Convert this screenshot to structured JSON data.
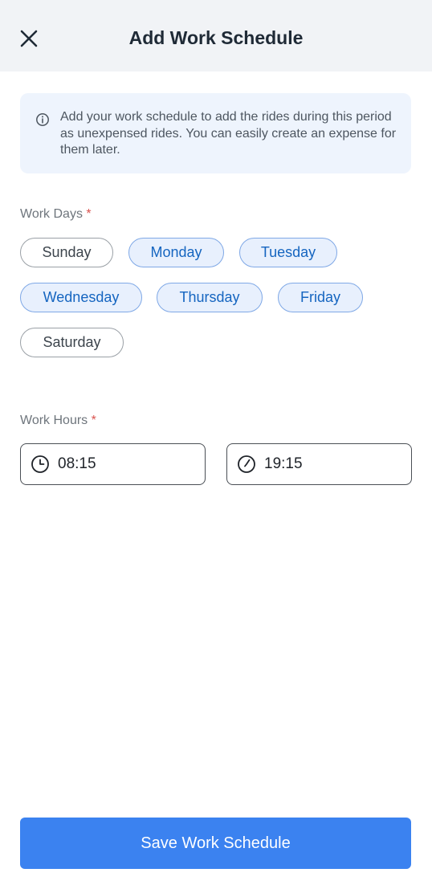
{
  "header": {
    "title": "Add Work Schedule",
    "close_icon": "close-icon"
  },
  "info": {
    "icon": "info-icon",
    "lines": [
      "Add your work schedule to add the rides during this period",
      "as unexpensed rides. You can easily create an expense for",
      "them later."
    ]
  },
  "work_days": {
    "label": "Work Days",
    "required_mark": "*",
    "days": [
      {
        "label": "Sunday",
        "selected": false
      },
      {
        "label": "Monday",
        "selected": true
      },
      {
        "label": "Tuesday",
        "selected": true
      },
      {
        "label": "Wednesday",
        "selected": true
      },
      {
        "label": "Thursday",
        "selected": true
      },
      {
        "label": "Friday",
        "selected": true
      },
      {
        "label": "Saturday",
        "selected": false
      }
    ]
  },
  "work_hours": {
    "label": "Work Hours",
    "required_mark": "*",
    "start": {
      "value": "08:15",
      "icon": "clock-icon"
    },
    "end": {
      "value": "19:15",
      "icon": "clock-icon"
    }
  },
  "save_button": {
    "label": "Save Work Schedule"
  },
  "colors": {
    "accent": "#3b82f0",
    "chip_selected_bg": "#e8f0fd",
    "chip_selected_text": "#1565c0",
    "required": "#d9534f",
    "header_bg": "#f1f3f6",
    "info_bg": "#eef4fd"
  }
}
